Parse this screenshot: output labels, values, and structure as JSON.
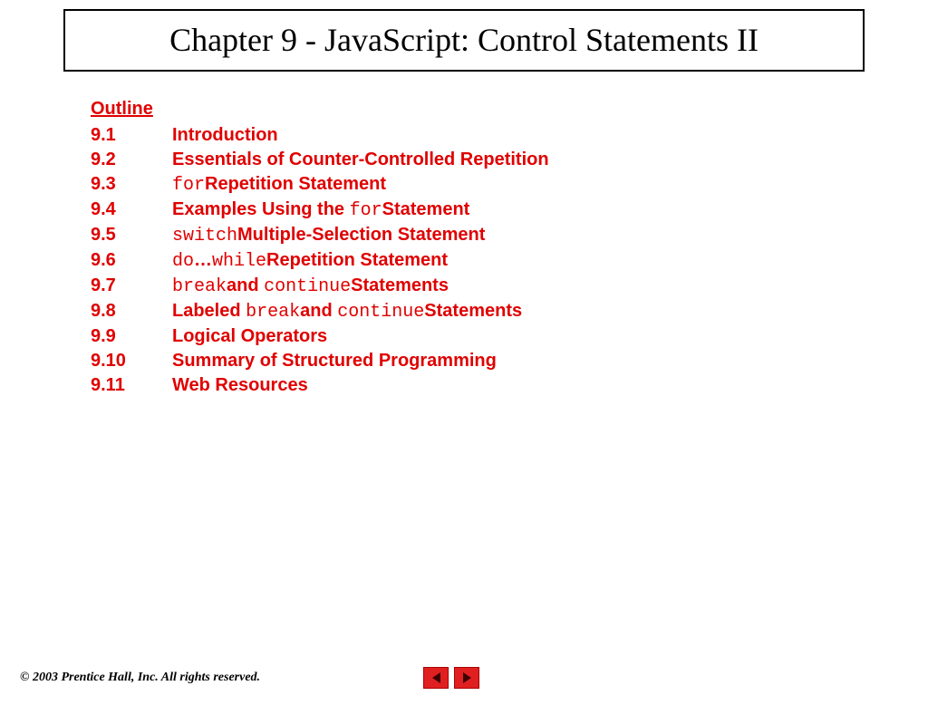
{
  "title": "Chapter 9 - JavaScript: Control Statements II",
  "outline_heading": "Outline",
  "items": [
    {
      "num": "9.1",
      "parts": [
        {
          "t": "Introduction"
        }
      ]
    },
    {
      "num": "9.2",
      "parts": [
        {
          "t": "Essentials of Counter-Controlled Repetition"
        }
      ]
    },
    {
      "num": "9.3",
      "parts": [
        {
          "t": "for",
          "mono": true
        },
        {
          "t": "Repetition Statement"
        }
      ]
    },
    {
      "num": "9.4",
      "parts": [
        {
          "t": "Examples Using the "
        },
        {
          "t": "for",
          "mono": true
        },
        {
          "t": "Statement"
        }
      ]
    },
    {
      "num": "9.5",
      "parts": [
        {
          "t": "switch",
          "mono": true
        },
        {
          "t": "Multiple-Selection Statement"
        }
      ]
    },
    {
      "num": "9.6",
      "parts": [
        {
          "t": "do",
          "mono": true
        },
        {
          "t": "…"
        },
        {
          "t": "while",
          "mono": true
        },
        {
          "t": "Repetition Statement"
        }
      ]
    },
    {
      "num": "9.7",
      "parts": [
        {
          "t": "break",
          "mono": true
        },
        {
          "t": "and "
        },
        {
          "t": "continue",
          "mono": true
        },
        {
          "t": "Statements"
        }
      ]
    },
    {
      "num": "9.8",
      "parts": [
        {
          "t": "Labeled "
        },
        {
          "t": "break",
          "mono": true
        },
        {
          "t": "and "
        },
        {
          "t": "continue",
          "mono": true
        },
        {
          "t": "Statements"
        }
      ]
    },
    {
      "num": "9.9",
      "parts": [
        {
          "t": "Logical Operators"
        }
      ]
    },
    {
      "num": "9.10",
      "parts": [
        {
          "t": "Summary of Structured Programming"
        }
      ]
    },
    {
      "num": "9.11",
      "parts": [
        {
          "t": "Web Resources"
        }
      ]
    }
  ],
  "copyright": "© 2003 Prentice Hall, Inc.  All rights reserved."
}
